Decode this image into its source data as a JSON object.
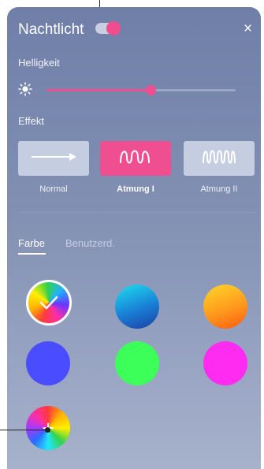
{
  "header": {
    "title": "Nachtlicht",
    "toggle_on": true,
    "close_symbol": "×"
  },
  "brightness": {
    "label": "Helligkeit",
    "value_fraction": 0.55
  },
  "effect": {
    "label": "Effekt",
    "options": [
      {
        "label": "Normal",
        "icon": "arrow-right-icon",
        "selected": false
      },
      {
        "label": "Atmung I",
        "icon": "wave-icon",
        "selected": true
      },
      {
        "label": "Atmung II",
        "icon": "wave-fast-icon",
        "selected": false
      }
    ]
  },
  "tabs": [
    {
      "label": "Farbe",
      "active": true
    },
    {
      "label": "Benutzerd.",
      "active": false
    }
  ],
  "colors": {
    "accent": "#ef4f90",
    "swatches": [
      {
        "name": "rainbow",
        "selected": true
      },
      {
        "name": "cyan-blue-gradient",
        "selected": false
      },
      {
        "name": "yellow-orange-gradient",
        "selected": false
      },
      {
        "name": "indigo",
        "selected": false
      },
      {
        "name": "green",
        "selected": false
      },
      {
        "name": "magenta",
        "selected": false
      }
    ],
    "add_symbol": "+"
  }
}
